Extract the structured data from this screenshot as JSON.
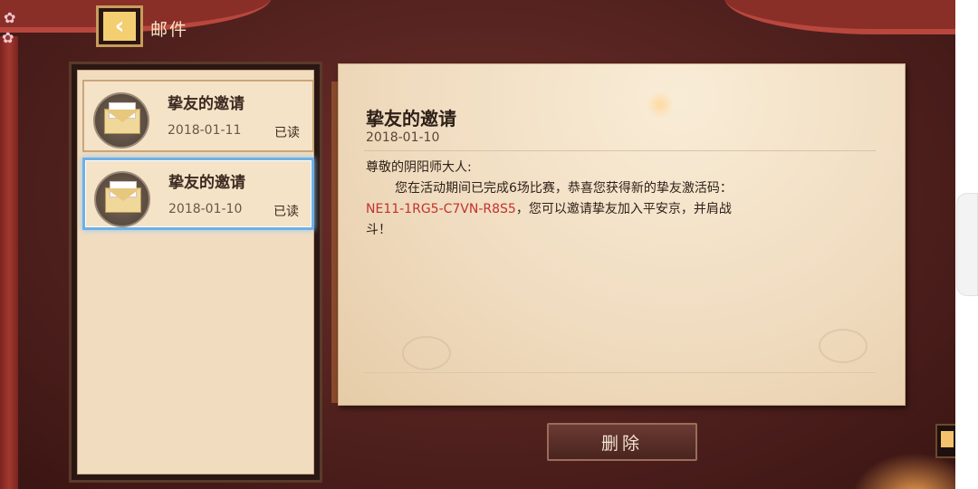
{
  "header": {
    "title": "邮件",
    "back_icon": "chevron-left-icon"
  },
  "mail_list": [
    {
      "title": "挚友的邀请",
      "date": "2018-01-11",
      "status": "已读",
      "selected": false,
      "icon": "envelope-icon"
    },
    {
      "title": "挚友的邀请",
      "date": "2018-01-10",
      "status": "已读",
      "selected": true,
      "icon": "envelope-icon"
    }
  ],
  "letter": {
    "title": "挚友的邀请",
    "date": "2018-01-10",
    "greeting": "尊敬的阴阳师大人:",
    "line1": "您在活动期间已完成6场比赛，恭喜您获得新的挚友激活码：",
    "code": "NE11-1RG5-C7VN-R8S5",
    "line2": "，您可以邀请挚友加入平安京，并肩战",
    "line3": "斗！"
  },
  "actions": {
    "delete_label": "删除"
  },
  "colors": {
    "accent_code": "#c0332d",
    "selection_border": "#6fb0e6"
  }
}
